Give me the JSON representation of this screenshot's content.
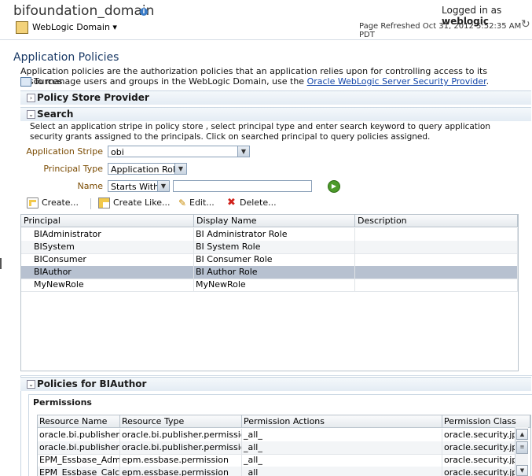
{
  "header": {
    "domain_title": "bifoundation_domain",
    "logged_in_prefix": "Logged in as",
    "logged_in_user": "weblogic",
    "domain_menu": "WebLogic Domain",
    "page_refreshed": "Page Refreshed Oct 31, 2012 5:52:35 AM PDT"
  },
  "app_policies": {
    "title": "Application Policies",
    "description": "Application policies are the authorization policies that an application relies upon for controlling access to its resources.",
    "manage_prefix": "To manage users and groups in the WebLogic Domain, use the",
    "manage_link": "Oracle WebLogic Server Security Provider",
    "manage_suffix": "."
  },
  "policy_store": {
    "label": "Policy Store Provider"
  },
  "search": {
    "label": "Search",
    "description": "Select an application stripe in policy store , select principal type and enter search keyword to query application security grants assigned to the principals. Click on searched principal to query policies assigned.",
    "application_stripe_label": "Application Stripe",
    "application_stripe_value": "obi",
    "principal_type_label": "Principal Type",
    "principal_type_value": "Application Role",
    "name_label": "Name",
    "name_operator": "Starts With",
    "name_value": ""
  },
  "toolbar": {
    "create": "Create...",
    "create_like": "Create Like...",
    "edit": "Edit...",
    "delete": "Delete..."
  },
  "principals_table": {
    "columns": [
      "Principal",
      "Display Name",
      "Description"
    ],
    "rows": [
      {
        "principal": "BIAdministrator",
        "display_name": "BI Administrator Role",
        "description": ""
      },
      {
        "principal": "BISystem",
        "display_name": "BI System Role",
        "description": ""
      },
      {
        "principal": "BIConsumer",
        "display_name": "BI Consumer Role",
        "description": ""
      },
      {
        "principal": "BIAuthor",
        "display_name": "BI Author Role",
        "description": "",
        "selected": true
      },
      {
        "principal": "MyNewRole",
        "display_name": "MyNewRole",
        "description": ""
      }
    ]
  },
  "policies": {
    "label": "Policies for BIAuthor",
    "permissions_label": "Permissions",
    "columns": [
      "Resource Name",
      "Resource Type",
      "Permission Actions",
      "Permission Class"
    ],
    "rows": [
      {
        "resource_name": "oracle.bi.publisher.de",
        "resource_type": "oracle.bi.publisher.permission",
        "actions": "_all_",
        "class": "oracle.security.jps."
      },
      {
        "resource_name": "oracle.bi.publisher.de",
        "resource_type": "oracle.bi.publisher.permission",
        "actions": "_all_",
        "class": "oracle.security.jps."
      },
      {
        "resource_name": "EPM_Essbase_Admini",
        "resource_type": "epm.essbase.permission",
        "actions": "_all_",
        "class": "oracle.security.jps."
      },
      {
        "resource_name": "EPM_Essbase_Calcula",
        "resource_type": "epm.essbase.permission",
        "actions": "_all_",
        "class": "oracle.security.jps."
      }
    ]
  },
  "colors": {
    "accent": "#1245a8",
    "selected_row": "#b7c1d0",
    "section_header": "#e4ecf4"
  }
}
